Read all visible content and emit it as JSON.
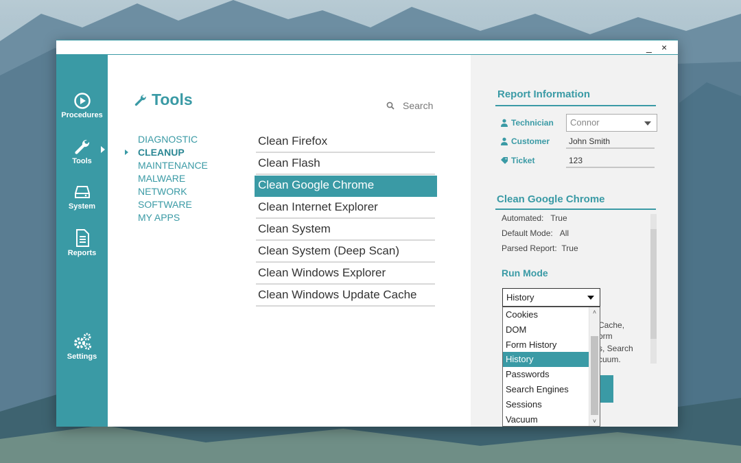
{
  "window": {
    "minimize_label": "_",
    "close_label": "×"
  },
  "sidebar": {
    "items": [
      {
        "label": "Procedures",
        "icon": "play-circle-icon"
      },
      {
        "label": "Tools",
        "icon": "wrench-icon",
        "active": true
      },
      {
        "label": "System",
        "icon": "hard-drive-icon"
      },
      {
        "label": "Reports",
        "icon": "document-icon"
      },
      {
        "label": "Settings",
        "icon": "gears-icon"
      }
    ]
  },
  "main": {
    "title": "Tools",
    "search_placeholder": "Search",
    "categories": [
      "DIAGNOSTIC",
      "CLEANUP",
      "MAINTENANCE",
      "MALWARE",
      "NETWORK",
      "SOFTWARE",
      "MY APPS"
    ],
    "active_category": "CLEANUP",
    "tasks": [
      "Clean Firefox",
      "Clean Flash",
      "Clean Google Chrome",
      "Clean Internet Explorer",
      "Clean System",
      "Clean System (Deep Scan)",
      "Clean Windows Explorer",
      "Clean Windows Update Cache"
    ],
    "selected_task": "Clean Google Chrome"
  },
  "report": {
    "title": "Report Information",
    "technician_label": "Technician",
    "technician_value": "Connor",
    "customer_label": "Customer",
    "customer_value": "John Smith",
    "ticket_label": "Ticket",
    "ticket_value": "123"
  },
  "details": {
    "title": "Clean Google Chrome",
    "automated_label": "Automated:",
    "automated_value": "True",
    "default_mode_label": "Default Mode:",
    "default_mode_value": "All",
    "parsed_report_label": "Parsed Report:",
    "parsed_report_value": "True",
    "run_mode_title": "Run Mode",
    "partial_text": [
      "Cache,",
      "orm",
      "s, Search",
      "cuum."
    ]
  },
  "run_mode": {
    "selected": "History",
    "options": [
      "Cookies",
      "DOM",
      "Form History",
      "History",
      "Passwords",
      "Search Engines",
      "Sessions",
      "Vacuum"
    ]
  },
  "colors": {
    "accent": "#3a9aa5",
    "panel_bg": "#f2f2f2",
    "selected_fg": "#ffffff"
  }
}
